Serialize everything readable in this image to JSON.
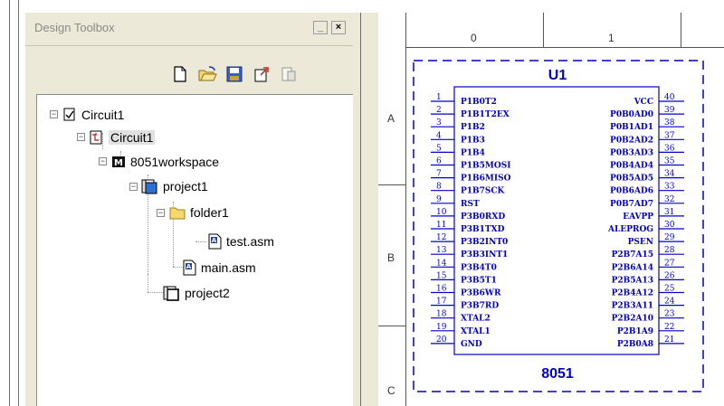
{
  "toolbox": {
    "title": "Design Toolbox",
    "minimize_label": "_",
    "close_label": "×",
    "icons": [
      "new-file-icon",
      "open-folder-icon",
      "save-icon",
      "export-icon",
      "properties-icon"
    ],
    "tree": {
      "items": [
        {
          "label": "Circuit1",
          "icon": "checkbox-icon"
        },
        {
          "label": "Circuit1",
          "icon": "circuit-icon"
        },
        {
          "label": "8051workspace",
          "icon": "workspace-icon"
        },
        {
          "label": "project1",
          "icon": "project-icon"
        },
        {
          "label": "folder1",
          "icon": "folder-icon"
        },
        {
          "label": "test.asm",
          "icon": "asm-file-icon"
        },
        {
          "label": "main.asm",
          "icon": "asm-file-icon"
        },
        {
          "label": "project2",
          "icon": "project-icon"
        }
      ]
    }
  },
  "schematic": {
    "columns": [
      "0",
      "1"
    ],
    "rows": [
      "A",
      "B",
      "C"
    ],
    "component": {
      "ref": "U1",
      "part": "8051",
      "left_pins": [
        {
          "num": "1",
          "name": "P1B0T2"
        },
        {
          "num": "2",
          "name": "P1B1T2EX"
        },
        {
          "num": "3",
          "name": "P1B2"
        },
        {
          "num": "4",
          "name": "P1B3"
        },
        {
          "num": "5",
          "name": "P1B4"
        },
        {
          "num": "6",
          "name": "P1B5MOSI"
        },
        {
          "num": "7",
          "name": "P1B6MISO"
        },
        {
          "num": "8",
          "name": "P1B7SCK"
        },
        {
          "num": "9",
          "name": "RST"
        },
        {
          "num": "10",
          "name": "P3B0RXD"
        },
        {
          "num": "11",
          "name": "P3B1TXD"
        },
        {
          "num": "12",
          "name": "P3B2INT0"
        },
        {
          "num": "13",
          "name": "P3B3INT1"
        },
        {
          "num": "14",
          "name": "P3B4T0"
        },
        {
          "num": "15",
          "name": "P3B5T1"
        },
        {
          "num": "16",
          "name": "P3B6WR"
        },
        {
          "num": "17",
          "name": "P3B7RD"
        },
        {
          "num": "18",
          "name": "XTAL2"
        },
        {
          "num": "19",
          "name": "XTAL1"
        },
        {
          "num": "20",
          "name": "GND"
        }
      ],
      "right_pins": [
        {
          "num": "40",
          "name": "VCC"
        },
        {
          "num": "39",
          "name": "P0B0AD0"
        },
        {
          "num": "38",
          "name": "P0B1AD1"
        },
        {
          "num": "37",
          "name": "P0B2AD2"
        },
        {
          "num": "36",
          "name": "P0B3AD3"
        },
        {
          "num": "35",
          "name": "P0B4AD4"
        },
        {
          "num": "34",
          "name": "P0B5AD5"
        },
        {
          "num": "33",
          "name": "P0B6AD6"
        },
        {
          "num": "32",
          "name": "P0B7AD7"
        },
        {
          "num": "31",
          "name": "EAVPP"
        },
        {
          "num": "30",
          "name": "ALEPROG"
        },
        {
          "num": "29",
          "name": "PSEN"
        },
        {
          "num": "28",
          "name": "P2B7A15"
        },
        {
          "num": "27",
          "name": "P2B6A14"
        },
        {
          "num": "26",
          "name": "P2B5A13"
        },
        {
          "num": "25",
          "name": "P2B4A12"
        },
        {
          "num": "24",
          "name": "P2B3A11"
        },
        {
          "num": "23",
          "name": "P2B2A10"
        },
        {
          "num": "22",
          "name": "P2B1A9"
        },
        {
          "num": "21",
          "name": "P2B0A8"
        }
      ]
    }
  }
}
